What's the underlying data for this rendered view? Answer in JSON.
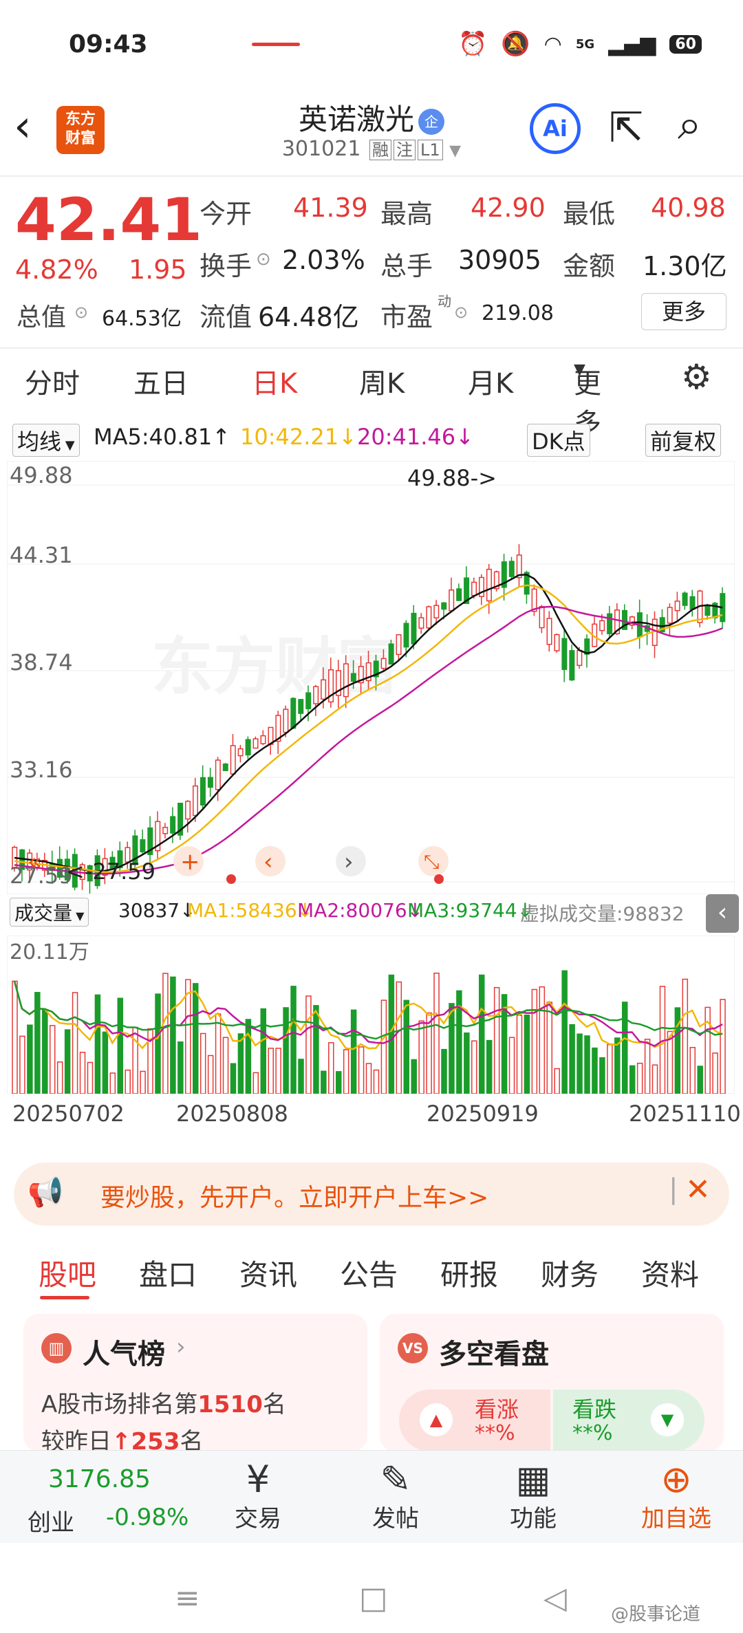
{
  "status_bar": {
    "time": "09:43",
    "network": "5G",
    "battery": "60"
  },
  "header": {
    "logo_line1": "东方",
    "logo_line2": "财富",
    "stock_name": "英诺激光",
    "badge": "企",
    "stock_code": "301021",
    "tags": [
      "融",
      "注",
      "L1"
    ],
    "ai_label": "Ai"
  },
  "quote": {
    "price": "42.41",
    "change_pct": "4.82%",
    "change": "1.95",
    "open_label": "今开",
    "open": "41.39",
    "high_label": "最高",
    "high": "42.90",
    "low_label": "最低",
    "low": "40.98",
    "turnover_label": "换手",
    "turnover": "2.03%",
    "volume_label": "总手",
    "volume": "30905",
    "amount_label": "金额",
    "amount": "1.30亿",
    "mktcap_label": "总值",
    "mktcap": "64.53亿",
    "float_label": "流值",
    "float": "64.48亿",
    "pe_label": "市盈",
    "pe_sup": "动",
    "pe": "219.08",
    "more": "更多"
  },
  "chart_tabs": [
    "分时",
    "五日",
    "日K",
    "周K",
    "月K",
    "更多"
  ],
  "ma_bar": {
    "select": "均线",
    "ma5": "MA5:40.81↑",
    "ma10": "10:42.21↓",
    "ma20": "20:41.46↓",
    "dk": "DK点",
    "fq": "前复权"
  },
  "price_axis": [
    "49.88",
    "44.31",
    "38.74",
    "33.16",
    "27.59"
  ],
  "annotations": {
    "high": "49.88->",
    "low": "<-27.59"
  },
  "watermark": "东方财富",
  "vol_bar": {
    "select": "成交量",
    "vol": "30837↓",
    "ma1": "MA1:58436↓",
    "ma2": "MA2:80076↓",
    "ma3": "MA3:93744↓",
    "virtual": "虚拟成交量:98832",
    "axis_max": "20.11万"
  },
  "dates": [
    "20250702",
    "20250808",
    "20250919",
    "20251110"
  ],
  "colors": {
    "up": "#e53935",
    "down": "#1a9c2b",
    "ma5": "#111111",
    "ma10": "#f2b705",
    "ma20": "#c2189c",
    "ma3": "#1a9c2b"
  },
  "chart_data": {
    "type": "candlestick",
    "y_range": [
      27.59,
      49.88
    ],
    "high": 49.88,
    "low": 27.59,
    "last_close": 42.41,
    "x_labels": [
      "20250702",
      "20250808",
      "20250919",
      "20251110"
    ]
  },
  "banner": {
    "text": "要炒股，先开户。立即开户上车>>"
  },
  "section_tabs": [
    "股吧",
    "盘口",
    "资讯",
    "公告",
    "研报",
    "财务",
    "资料"
  ],
  "cards": {
    "left_title": "人气榜",
    "left_line1_a": "A股市场排名第",
    "left_line1_b": "1510",
    "left_line1_c": "名",
    "left_line2_a": "较昨日",
    "left_line2_b": "253",
    "left_line2_c": "名",
    "right_title": "多空看盘",
    "bull_label": "看涨",
    "bull_val": "**%",
    "bear_label": "看跌",
    "bear_val": "**%"
  },
  "bottom_bar": {
    "index_value": "3176.85",
    "index_name": "创业",
    "index_pct": "-0.98%",
    "trade": "交易",
    "post": "发帖",
    "func": "功能",
    "add": "加自选"
  },
  "watermark_user": "@股事论道"
}
